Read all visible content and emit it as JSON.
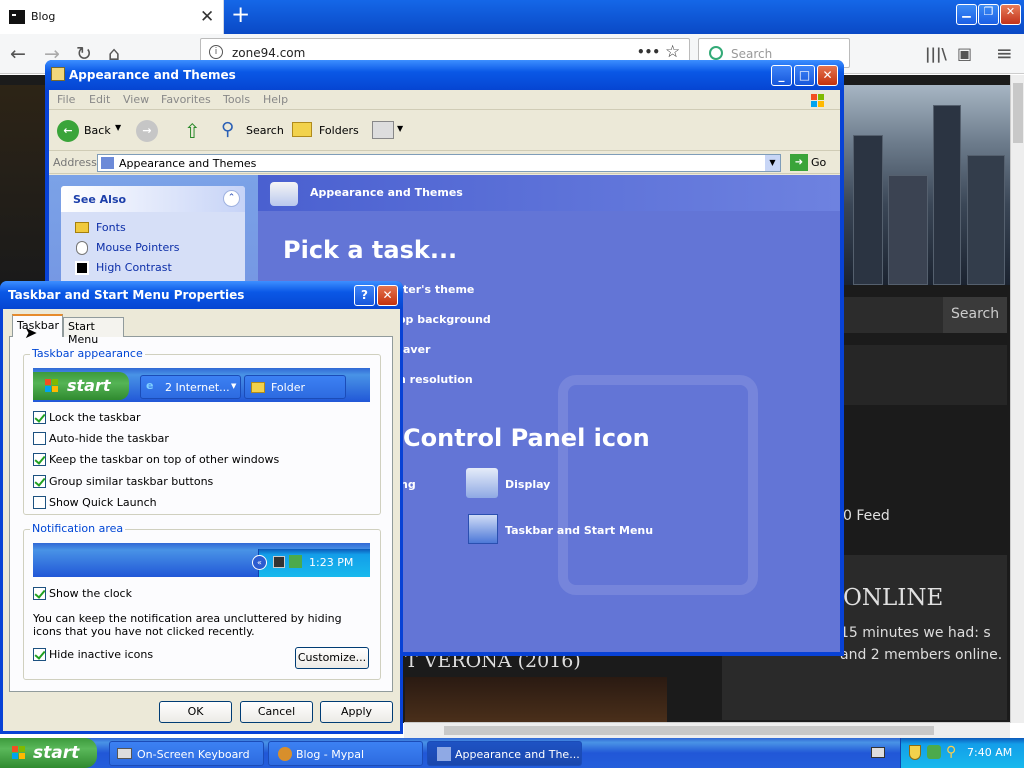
{
  "firefox": {
    "tab_title": "Blog",
    "tab_close": "✕",
    "new_tab": "+",
    "url": "zone94.com",
    "search_placeholder": "Search",
    "page_actions": "•••",
    "bookmark_star": "☆",
    "library_icon": "|||\\",
    "sidebar_icon": "▣",
    "menu_icon": "≡"
  },
  "website": {
    "search_button": "Search",
    "feed_text": "0 Feed",
    "online_heading": "ONLINE",
    "online_text": "15 minutes we had: s and 2 members online.",
    "movie_title": "T VERONA (2016)"
  },
  "explorer": {
    "title": "Appearance and Themes",
    "menu": [
      "File",
      "Edit",
      "View",
      "Favorites",
      "Tools",
      "Help"
    ],
    "toolbar": {
      "back": "Back",
      "search": "Search",
      "folders": "Folders"
    },
    "address_label": "Address",
    "address_value": "Appearance and Themes",
    "go": "Go",
    "see_also": {
      "heading": "See Also",
      "links": [
        "Fonts",
        "Mouse Pointers",
        "High Contrast"
      ]
    },
    "header": "Appearance and Themes",
    "pick_task": "Pick a task...",
    "tasks": [
      "ter's theme",
      "op background",
      "aver",
      "n resolution"
    ],
    "pick_icon": "Control Panel icon",
    "icons": [
      "ng",
      "Display",
      "Taskbar and Start Menu"
    ]
  },
  "dialog": {
    "title": "Taskbar and Start Menu Properties",
    "help": "?",
    "close": "✕",
    "tabs": [
      "Taskbar",
      "Start Menu"
    ],
    "appearance_group": "Taskbar appearance",
    "preview_start": "start",
    "preview_ie": "2 Internet...",
    "preview_folder": "Folder",
    "checks": [
      {
        "label": "Lock the taskbar",
        "checked": true
      },
      {
        "label": "Auto-hide the taskbar",
        "checked": false
      },
      {
        "label": "Keep the taskbar on top of other windows",
        "checked": true
      },
      {
        "label": "Group similar taskbar buttons",
        "checked": true
      },
      {
        "label": "Show Quick Launch",
        "checked": false
      }
    ],
    "notify_group": "Notification area",
    "tray_time": "1:23 PM",
    "show_clock": "Show the clock",
    "description": "You can keep the notification area uncluttered by hiding icons that you have not clicked recently.",
    "hide_inactive": "Hide inactive icons",
    "customize": "Customize...",
    "ok": "OK",
    "cancel": "Cancel",
    "apply": "Apply"
  },
  "taskbar": {
    "start": "start",
    "tasks": [
      "On-Screen Keyboard",
      "Blog - Mypal",
      "Appearance and The..."
    ],
    "clock": "7:40 AM"
  }
}
